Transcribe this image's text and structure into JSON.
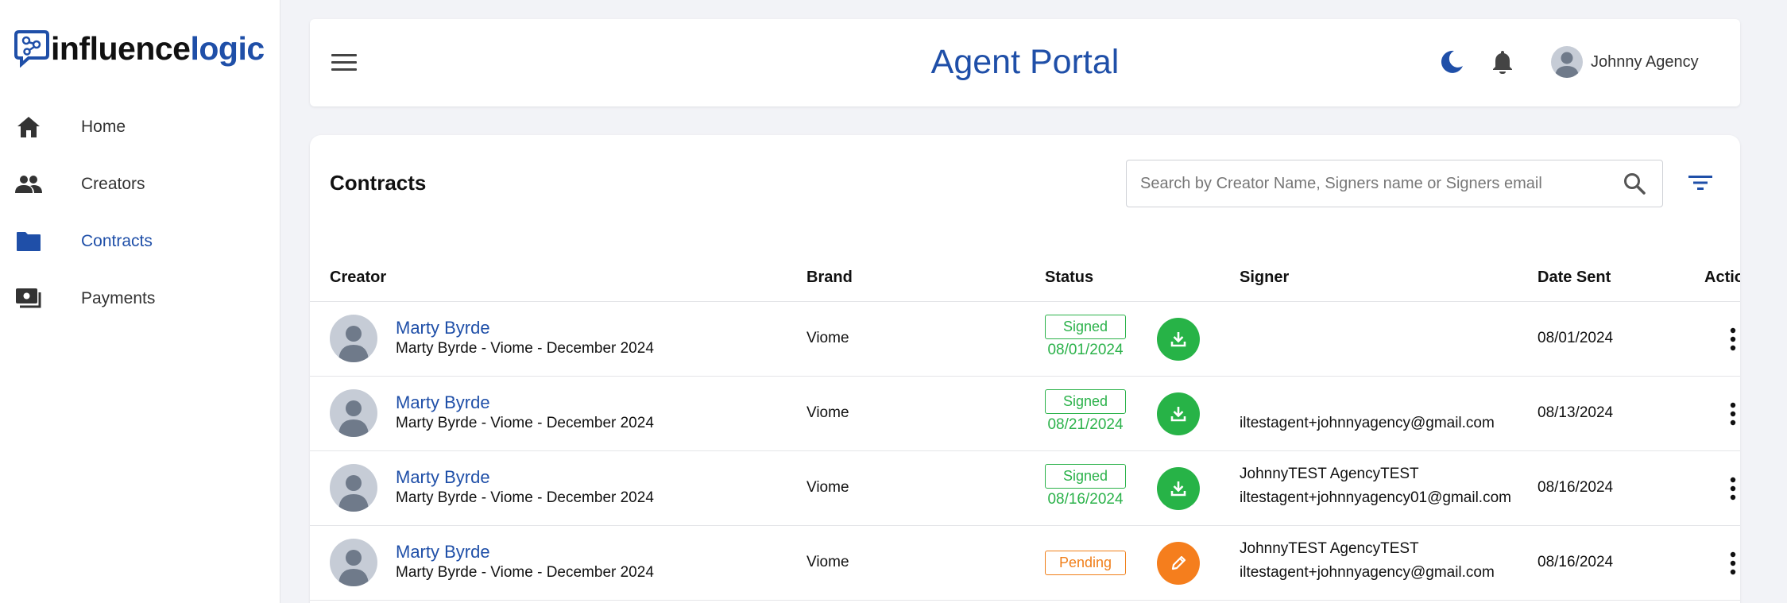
{
  "logo": {
    "part1": "influence",
    "part2": "logic"
  },
  "sidebar": {
    "items": [
      {
        "label": "Home",
        "icon": "home-icon",
        "active": false
      },
      {
        "label": "Creators",
        "icon": "people-icon",
        "active": false
      },
      {
        "label": "Contracts",
        "icon": "folder-icon",
        "active": true
      },
      {
        "label": "Payments",
        "icon": "payments-icon",
        "active": false
      }
    ]
  },
  "header": {
    "title": "Agent Portal",
    "user_name": "Johnny Agency"
  },
  "contracts": {
    "title": "Contracts",
    "search_placeholder": "Search by Creator Name, Signers name or Signers email",
    "columns": [
      "Creator",
      "Brand",
      "Status",
      "Signer",
      "Date Sent",
      "Actions"
    ],
    "rows": [
      {
        "creator": "Marty Byrde",
        "contract": "Marty Byrde - Viome - December 2024",
        "brand": "Viome",
        "status": "Signed",
        "status_date": "08/01/2024",
        "signer_name": "",
        "signer_email": "",
        "date_sent": "08/01/2024"
      },
      {
        "creator": "Marty Byrde",
        "contract": "Marty Byrde - Viome - December 2024",
        "brand": "Viome",
        "status": "Signed",
        "status_date": "08/21/2024",
        "signer_name": "",
        "signer_email": "iltestagent+johnnyagency@gmail.com",
        "date_sent": "08/13/2024"
      },
      {
        "creator": "Marty Byrde",
        "contract": "Marty Byrde - Viome - December 2024",
        "brand": "Viome",
        "status": "Signed",
        "status_date": "08/16/2024",
        "signer_name": "JohnnyTEST AgencyTEST",
        "signer_email": "iltestagent+johnnyagency01@gmail.com",
        "date_sent": "08/16/2024"
      },
      {
        "creator": "Marty Byrde",
        "contract": "Marty Byrde - Viome - December 2024",
        "brand": "Viome",
        "status": "Pending",
        "status_date": "",
        "signer_name": "JohnnyTEST AgencyTEST",
        "signer_email": "iltestagent+johnnyagency@gmail.com",
        "date_sent": "08/16/2024"
      }
    ]
  },
  "colors": {
    "brand_blue": "#1f4fa8",
    "signed_green": "#2bb24a",
    "pending_orange": "#f07f1a"
  }
}
